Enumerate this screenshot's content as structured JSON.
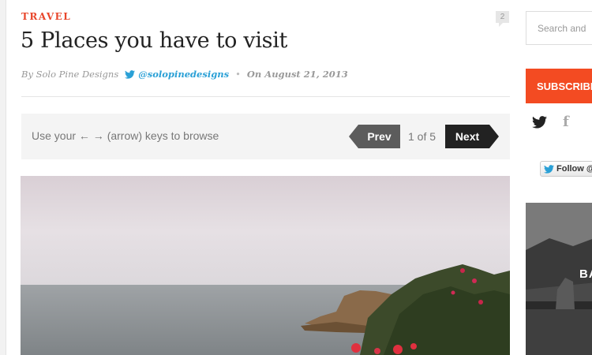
{
  "post": {
    "category": "TRAVEL",
    "comment_count": "2",
    "title": "5 Places you have to visit",
    "author": "By Solo Pine Designs",
    "twitter_handle": "@solopinedesigns",
    "date": "On August 21, 2013"
  },
  "gallery": {
    "hint": "Use your ← → (arrow) keys to browse",
    "prev_label": "Prev",
    "next_label": "Next",
    "position": "1 of 5"
  },
  "sidebar": {
    "search_placeholder": "Search and",
    "subscribe_label": "SUBSCRIBE",
    "follow_label": "Follow @",
    "widget_text": "BA"
  },
  "colors": {
    "accent": "#e8462b",
    "subscribe": "#f34b22",
    "twitter": "#2aa0d6",
    "next_button": "#222222",
    "prev_button": "#5c5c5c"
  }
}
